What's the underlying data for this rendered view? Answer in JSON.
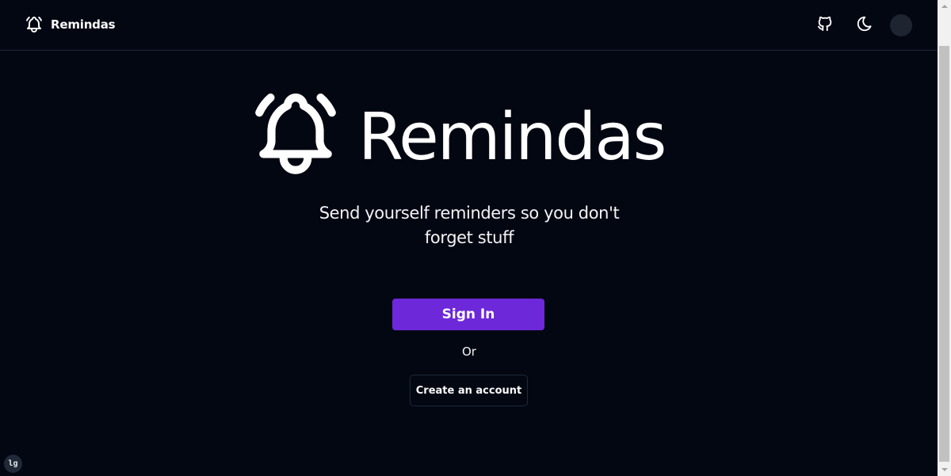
{
  "app": {
    "name": "Remindas"
  },
  "navbar": {
    "brand_label": "Remindas",
    "icons": {
      "brand": "bell-ringing-icon",
      "github": "github-icon",
      "theme": "moon-icon"
    }
  },
  "hero": {
    "title": "Remindas",
    "tagline": "Send yourself reminders so you don't forget stuff",
    "icon": "bell-ringing-icon"
  },
  "actions": {
    "sign_in_label": "Sign In",
    "or_label": "Or",
    "create_account_label": "Create an account"
  },
  "debug": {
    "breakpoint_label": "lg"
  },
  "colors": {
    "background": "#030712",
    "primary": "#6d28d9",
    "text": "#f9fafb",
    "border": "#1f2937"
  }
}
